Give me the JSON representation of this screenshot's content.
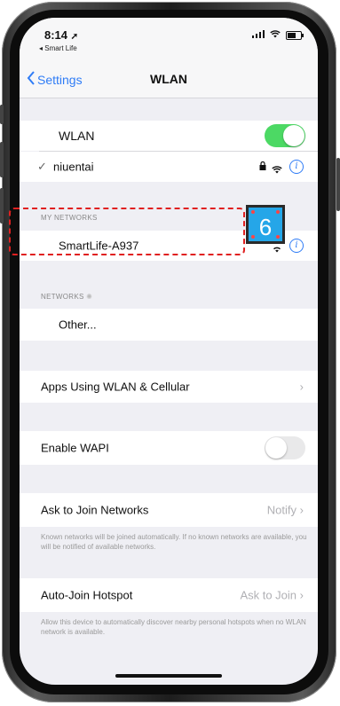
{
  "status_bar": {
    "time": "8:14",
    "back_app": "◂ Smart Life"
  },
  "navbar": {
    "back_label": "Settings",
    "title": "WLAN"
  },
  "wlan": {
    "label": "WLAN",
    "connected_network": "niuentai"
  },
  "my_networks": {
    "header": "MY NETWORKS",
    "items": [
      {
        "name": "SmartLife-A937"
      }
    ]
  },
  "networks": {
    "header": "NETWORKS",
    "other_label": "Other..."
  },
  "apps_using": {
    "label": "Apps Using WLAN & Cellular"
  },
  "wapi": {
    "label": "Enable WAPI"
  },
  "ask_join": {
    "label": "Ask to Join Networks",
    "value": "Notify",
    "note": "Known networks will be joined automatically. If no known networks are available, you will be notified of available networks."
  },
  "auto_join": {
    "label": "Auto-Join Hotspot",
    "value": "Ask to Join",
    "note": "Allow this device to automatically discover nearby personal hotspots when no WLAN network is available."
  },
  "annotation": {
    "badge_number": "6"
  },
  "colors": {
    "accent": "#2f7cf6",
    "toggle_on": "#4cd964",
    "annotation_red": "#e02020",
    "badge_blue": "#25a6e8"
  }
}
